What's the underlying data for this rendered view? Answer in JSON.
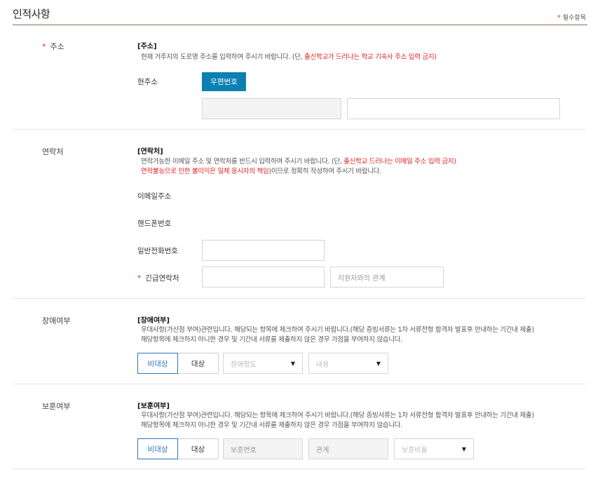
{
  "header": {
    "title": "인적사항",
    "required_star": "*",
    "required_label": "필수항목"
  },
  "address": {
    "label_star": "*",
    "label": "주소",
    "heading": "[주소]",
    "desc_prefix": "현재 거주지의 도로명 주소를 입력하여 주시기 바랍니다. (단, ",
    "desc_red": "출신학교가 드러나는 학교 기숙사 주소 입력 금지)",
    "current_label": "현주소",
    "zip_button": "우편번호",
    "zip_value": "",
    "detail_value": ""
  },
  "contact": {
    "label": "연락처",
    "heading": "[연락처]",
    "desc1_prefix": "연락가능한 이메일 주소 및 연락처를 반드시 입력하여 주시기 바랍니다. (단, ",
    "desc1_red": "출신학교 드러나는 이메일 주소 입력 금지)",
    "desc2_red": "연락불능으로 인한 불이익은 일체 응시자의 책임",
    "desc2_suffix": ")이므로  정확히 작성하여 주시기 바랍니다.",
    "email_label": "이메일주소",
    "mobile_label": "핸드폰번호",
    "phone_label": "일반전화번호",
    "phone_value": "",
    "emergency_star": "*",
    "emergency_label": "긴급연락처",
    "emergency_value": "",
    "relation_placeholder": "지원자와의 관계"
  },
  "disability": {
    "label": "장애여부",
    "heading": "[장애여부]",
    "desc1": "우대사항(가산점 부여)관련입니다. 해당되는 항목에 체크하여 주시기 바랍니다.(해당 증빙서류는 1차 서류전형 합격자 발표후 안내하는 기간내 제출)",
    "desc2": "해당항목에 체크하지 아니한 경우 및 기간내 서류를 제출하지 않은 경우 가점을 부여하지 않습니다.",
    "opt_no": "비대상",
    "opt_yes": "대상",
    "degree_select": "장애정도",
    "content_select": "내용",
    "arrow": "▼"
  },
  "veteran": {
    "label": "보훈여부",
    "heading": "[보훈여부]",
    "desc1": "우대사항(가산점 부여)관련입니다. 해당되는 항목에 체크하여 주시기 바랍니다.(해당 증빙서류는 1차 서류전형 합격자 발표후 안내하는 기간내 제출)",
    "desc2": "해당항목에 체크하지 아니한 경우 및 기간내 서류를 제출하지 않은 경우 가점을 부여하지 않습니다.",
    "opt_no": "비대상",
    "opt_yes": "대상",
    "number_placeholder": "보훈번호",
    "relation_placeholder": "관계",
    "ratio_select": "보훈비율",
    "arrow": "▼"
  }
}
